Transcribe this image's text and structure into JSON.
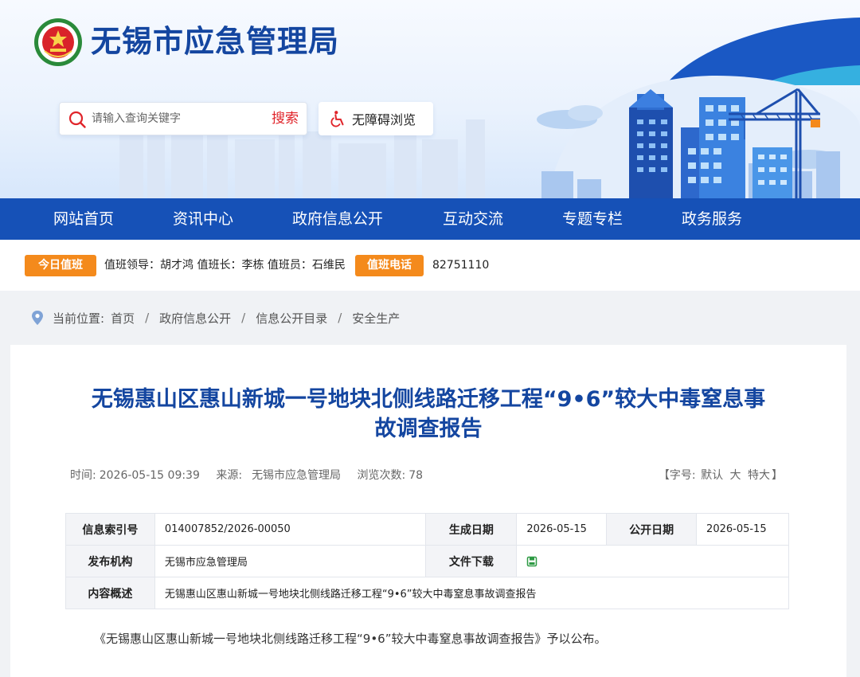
{
  "site": {
    "title": "无锡市应急管理局"
  },
  "search": {
    "placeholder": "请输入查询关键字",
    "button": "搜索"
  },
  "accessibility": {
    "label": "无障碍浏览"
  },
  "nav": {
    "items": [
      "网站首页",
      "资讯中心",
      "政府信息公开",
      "互动交流",
      "专题专栏",
      "政务服务"
    ]
  },
  "duty": {
    "tag_today": "今日值班",
    "today_text": "值班领导：胡才鸿 值班长：李栋 值班员：石维民",
    "tag_phone": "值班电话",
    "phone": "82751110"
  },
  "breadcrumb": {
    "prefix": "当前位置:",
    "items": [
      "首页",
      "政府信息公开",
      "信息公开目录",
      "安全生产"
    ],
    "separator": "/"
  },
  "article": {
    "title_line1": "无锡惠山区惠山新城一号地块北侧线路迁移工程“9•6”较大中毒窒息事",
    "title_line2": "故调查报告",
    "time_label": "时间:",
    "time": "2026-05-15 09:39",
    "source_label": "来源:",
    "source": "无锡市应急管理局",
    "views_label": "浏览次数:",
    "views": "78",
    "font_size_prefix": "【字号:",
    "font_size_options": [
      "默认",
      "大",
      "特大"
    ],
    "font_size_suffix": "】",
    "summary": "《无锡惠山区惠山新城一号地块北侧线路迁移工程“9•6”较大中毒窒息事故调查报告》予以公布。"
  },
  "info_table": {
    "index_label": "信息索引号",
    "index_value": "014007852/2026-00050",
    "created_label": "生成日期",
    "created_value": "2026-05-15",
    "public_label": "公开日期",
    "public_value": "2026-05-15",
    "publisher_label": "发布机构",
    "publisher_value": "无锡市应急管理局",
    "download_label": "文件下载",
    "overview_label": "内容概述",
    "overview_value": "无锡惠山区惠山新城一号地块北侧线路迁移工程“9•6”较大中毒窒息事故调查报告"
  },
  "colors": {
    "brand_blue": "#1651b7",
    "title_blue": "#1446a0",
    "tag_orange": "#f48a1c",
    "search_red": "#e0242a"
  }
}
